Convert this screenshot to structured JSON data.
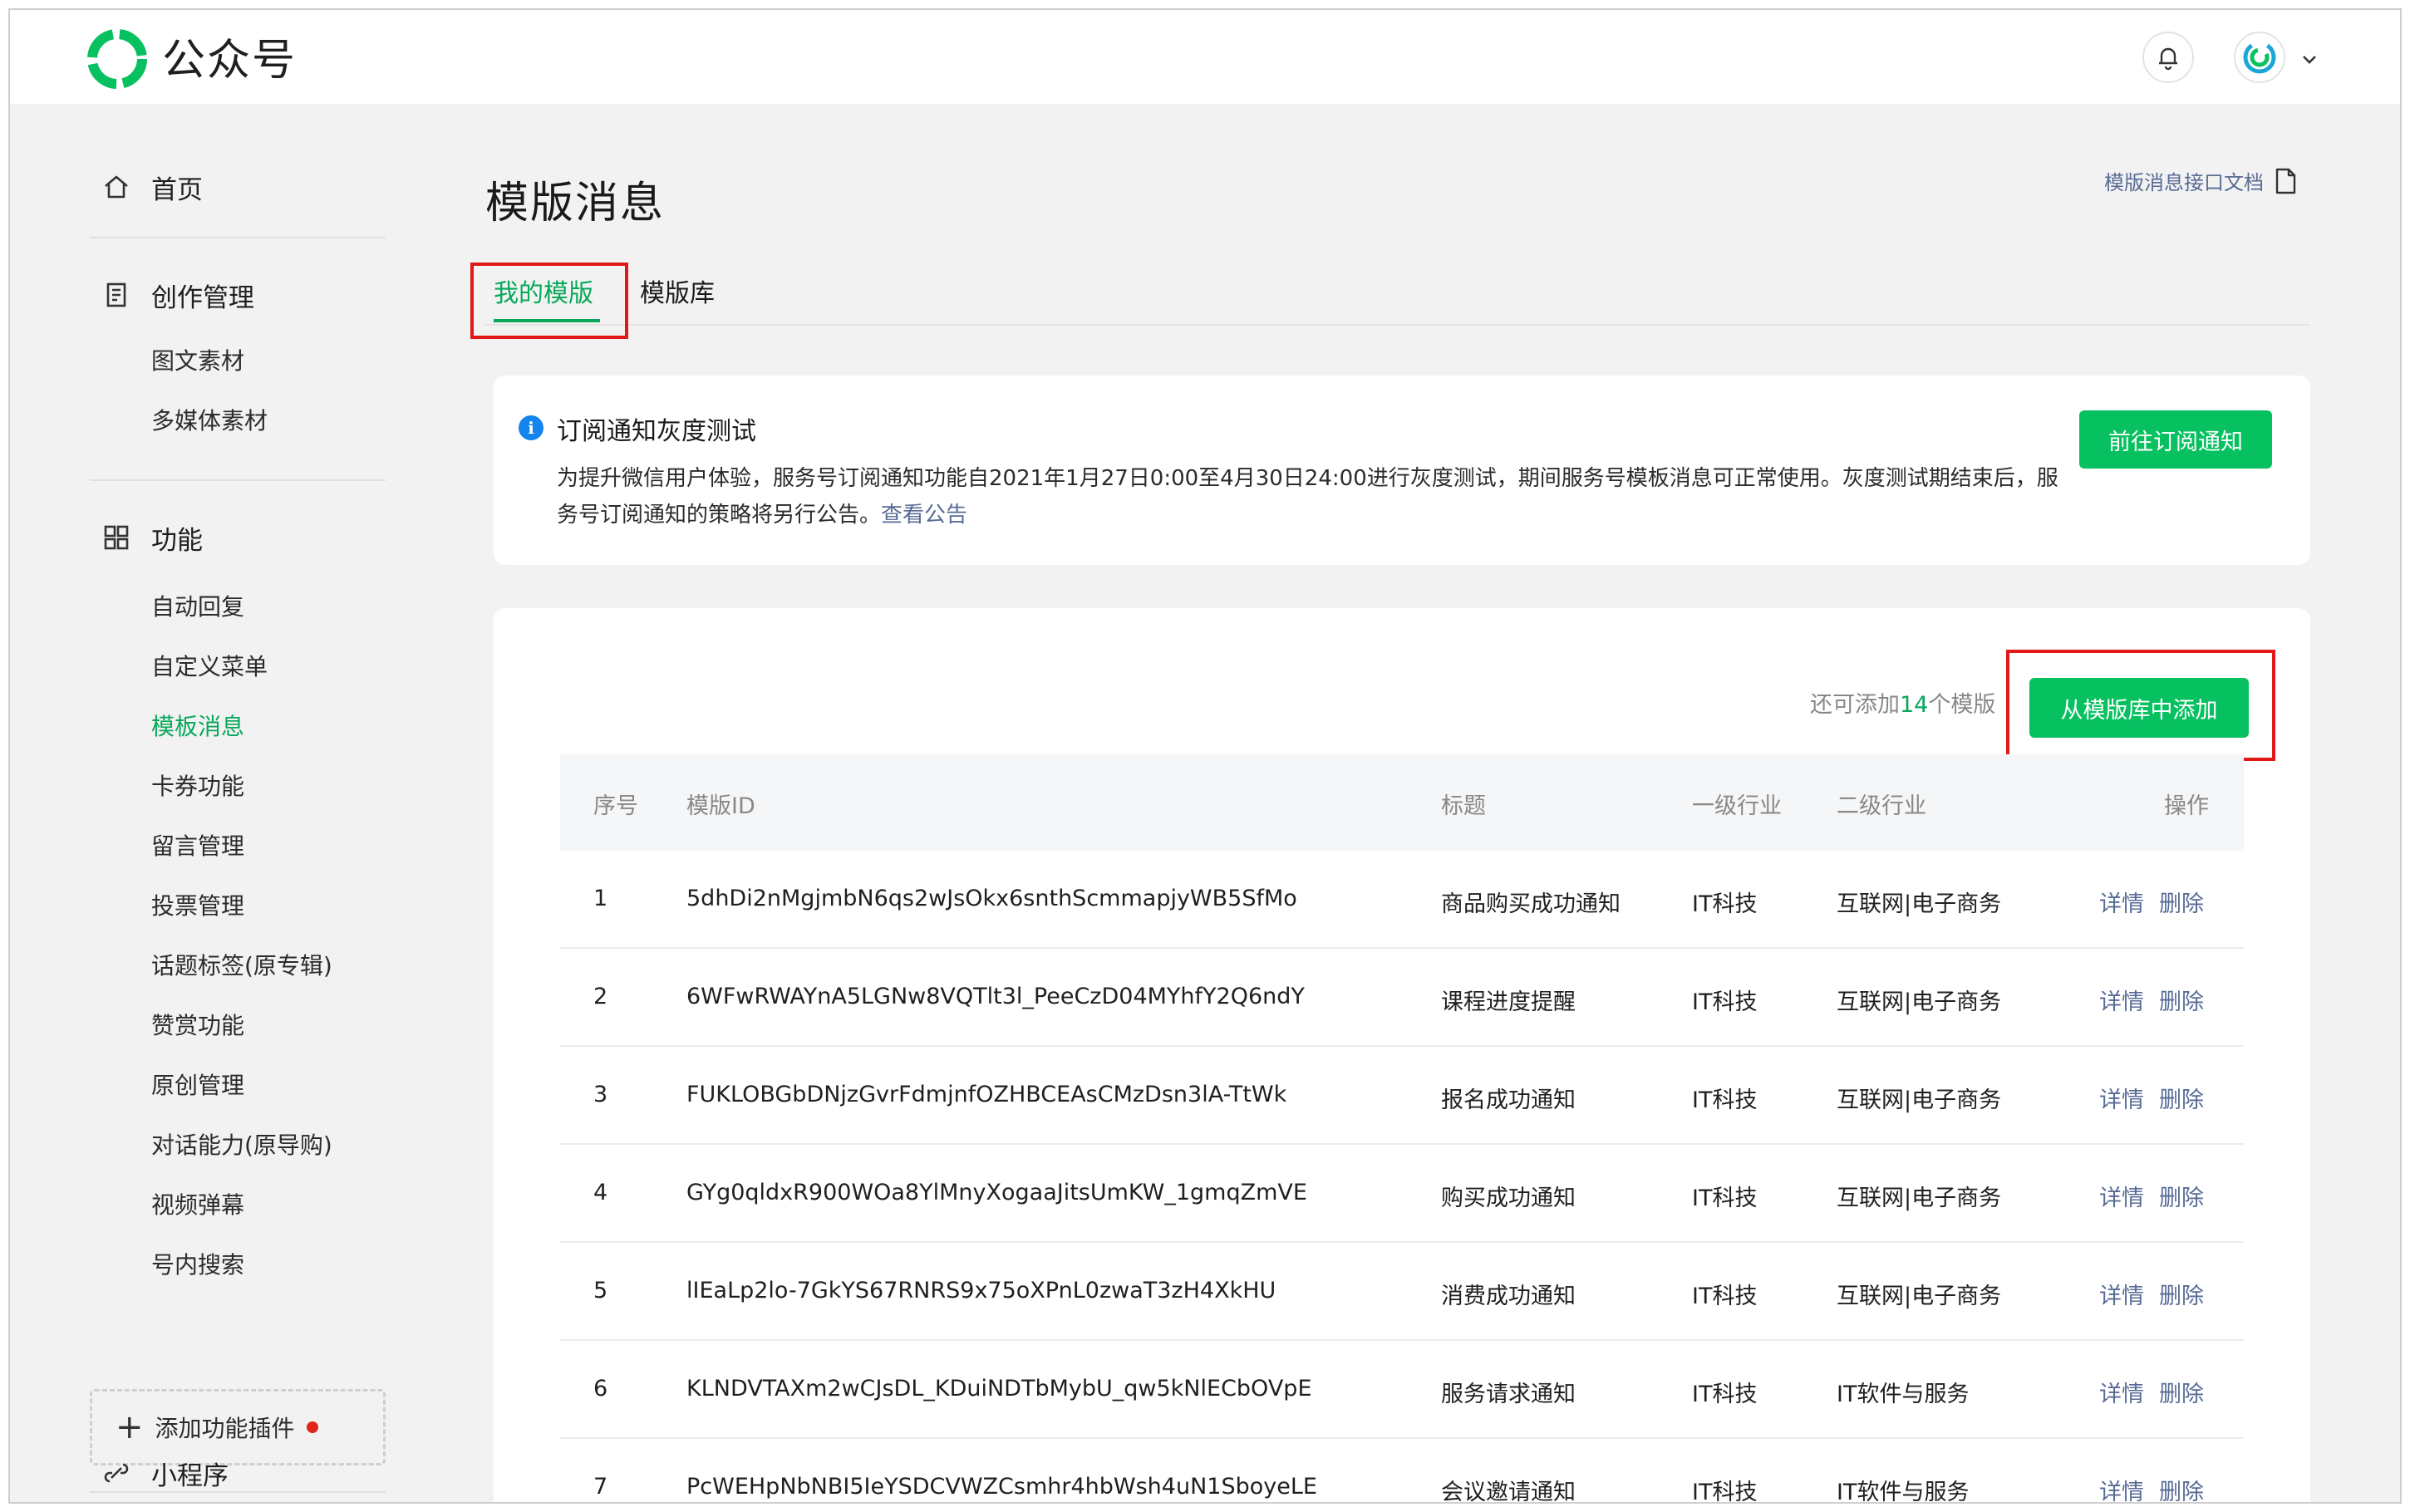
{
  "header": {
    "brand": "公众号",
    "colors": {
      "accent": "#07c160",
      "link": "#576b95",
      "highlight": "#e01818"
    }
  },
  "sidebar": {
    "home": "首页",
    "creation": "创作管理",
    "creation_items": [
      "图文素材",
      "多媒体素材"
    ],
    "features": "功能",
    "feature_items": [
      "自动回复",
      "自定义菜单",
      "模板消息",
      "卡券功能",
      "留言管理",
      "投票管理",
      "话题标签(原专辑)",
      "赞赏功能",
      "原创管理",
      "对话能力(原导购)",
      "视频弹幕",
      "号内搜索"
    ],
    "active_item": "模板消息",
    "add_plugin": "添加功能插件",
    "mini_program": "小程序"
  },
  "main": {
    "title": "模版消息",
    "doc_link": "模版消息接口文档",
    "tabs": [
      "我的模版",
      "模版库"
    ],
    "notice": {
      "title": "订阅通知灰度测试",
      "body": "为提升微信用户体验，服务号订阅通知功能自2021年1月27日0:00至4月30日24:00进行灰度测试，期间服务号模板消息可正常使用。灰度测试期结束后，服务号订阅通知的策略将另行公告。",
      "link": "查看公告",
      "button": "前往订阅通知"
    },
    "quota": {
      "prefix": "还可添加",
      "count": "14",
      "suffix": "个模版"
    },
    "add_button": "从模版库中添加",
    "table": {
      "headers": [
        "序号",
        "模版ID",
        "标题",
        "一级行业",
        "二级行业",
        "操作"
      ],
      "rows": [
        [
          "1",
          "5dhDi2nMgjmbN6qs2wJsOkx6snthScmmapjyWB5SfMo",
          "商品购买成功通知",
          "IT科技",
          "互联网|电子商务"
        ],
        [
          "2",
          "6WFwRWAYnA5LGNw8VQTlt3l_PeeCzD04MYhfY2Q6ndY",
          "课程进度提醒",
          "IT科技",
          "互联网|电子商务"
        ],
        [
          "3",
          "FUKLOBGbDNjzGvrFdmjnfOZHBCEAsCMzDsn3lA-TtWk",
          "报名成功通知",
          "IT科技",
          "互联网|电子商务"
        ],
        [
          "4",
          "GYg0qldxR900WOa8YlMnyXogaaJitsUmKW_1gmqZmVE",
          "购买成功通知",
          "IT科技",
          "互联网|电子商务"
        ],
        [
          "5",
          "lIEaLp2lo-7GkYS67RNRS9x75oXPnL0zwaT3zH4XkHU",
          "消费成功通知",
          "IT科技",
          "互联网|电子商务"
        ],
        [
          "6",
          "KLNDVTAXm2wCJsDL_KDuiNDTbMybU_qw5kNlECbOVpE",
          "服务请求通知",
          "IT科技",
          "IT软件与服务"
        ],
        [
          "7",
          "PcWEHpNbNBI5IeYSDCVWZCsmhr4hbWsh4uN1SboyeLE",
          "会议邀请通知",
          "IT科技",
          "IT软件与服务"
        ]
      ],
      "actions": [
        "详情",
        "删除"
      ]
    }
  }
}
